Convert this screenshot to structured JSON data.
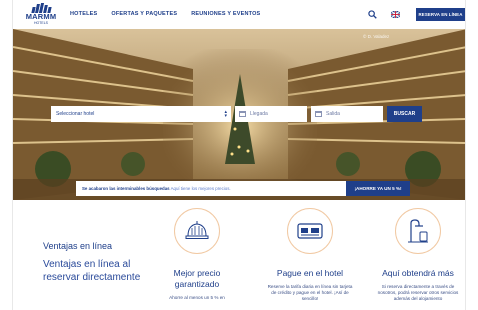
{
  "header": {
    "logo_word": "MARMM",
    "logo_sub": "HOTELS",
    "nav": [
      "HOTELES",
      "OFERTAS Y PAQUETES",
      "REUNIONES Y EVENTOS"
    ],
    "reserve_label": "RESERVA EN LÍNEA"
  },
  "hero": {
    "watermark": "© D. Valadez",
    "booking": {
      "hotel_placeholder": "Seleccionar hotel",
      "arrival_placeholder": "Llegada",
      "departure_placeholder": "Salida",
      "search_label": "BUSCAR"
    },
    "promo": {
      "text_bold": "Se acabaron las interminables búsquedas",
      "text_light": "Aquí tiene los mejores precios.",
      "button": "¡AHORRE YA UN 5 %!"
    }
  },
  "benefits": {
    "title": "Ventajas en línea",
    "subtitle": "Ventajas en línea al reservar directamente",
    "items": [
      {
        "icon": "bell-tray-icon",
        "title": "Mejor precio garantizado",
        "text": "Ahorre al menos un 5 % en"
      },
      {
        "icon": "credit-card-icon",
        "title": "Pague en el hotel",
        "text": "Reserve la tarifa diaria en línea sin tarjeta de crédito y pague en el hotel. ¡Así de sencillo!"
      },
      {
        "icon": "shower-icon",
        "title": "Aquí obtendrá más",
        "text": "Si reserva directamente a través de nosotros, podrá reservar otros servicios además del alojamiento"
      }
    ]
  },
  "colors": {
    "brand": "#1f3f8a",
    "accent": "#f1c9a3"
  }
}
